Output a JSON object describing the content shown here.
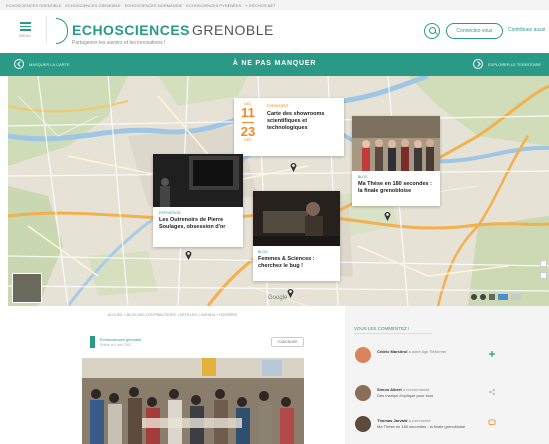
{
  "breadcrumb_top": [
    "ECHOSCIENCES GRENOBLE",
    "ECHOSCIENCES GRENOBLE",
    "ECHOSCIENCES NORMANDIE",
    "ECHOSCIENCES PYRÉNÉES",
    "+ D'ÉCHOS.NET"
  ],
  "header": {
    "menu_label": "MENU",
    "logo_main": "ECHOSCIENCES",
    "logo_city": "GRENOBLE",
    "tagline": "Partageons les savoirs et les innovations !",
    "connect_label": "Connectez-vous",
    "contribute_label": "Contribuez aussi"
  },
  "banner": {
    "left_label": "MASQUER LA CARTE",
    "title": "À NE PAS MANQUER",
    "right_label": "EXPLORER LE TERRITOIRE"
  },
  "map": {
    "cards": [
      {
        "kind": "event",
        "date_start": "11",
        "month_start": "DÉC",
        "date_end": "23",
        "month_end": "DÉC",
        "category": "ÉVÉNEMENT",
        "title": "Carte des showrooms scientifiques et technologiques"
      },
      {
        "kind": "article",
        "category": "EXPOSITION",
        "title": "Les Outrenoirs de Pierre Soulages, obsession d'or"
      },
      {
        "kind": "article",
        "category": "BLOG",
        "title": "Femmes & Sciences : cherchez le bug !"
      },
      {
        "kind": "article",
        "category": "BLOG",
        "title": "Ma Thèse en 180 secondes : la finale grenobloise"
      }
    ],
    "google_label": "Google"
  },
  "article": {
    "breadcrumb": "ACCUEIL > BLOG DES CONTRIBUTEURS > ARTICLES > AGENDA > DOSSIERS",
    "author_name": "Échosciences grenoble",
    "author_sub": "Publié le 6 déc 2017",
    "follow_label": "S'ABONNER"
  },
  "comments": {
    "title": "VOUS LES COMMENTEZ !",
    "items": [
      {
        "name": "Cédric Marsitrol",
        "action": "a aimé Agir Réformer",
        "text": "",
        "icon": "plus-icon",
        "avatar_color": "#d9845a"
      },
      {
        "name": "Simon Albert",
        "action": "a recommandé",
        "text": "Des manips d'optique pour tous",
        "icon": "share-icon",
        "avatar_color": "#8a6e55"
      },
      {
        "name": "Thomas Jarvaid",
        "action": "a commenté",
        "text": "Ma Thèse en 180 secondes : la finale grenobloise",
        "icon": "comment-icon",
        "avatar_color": "#5c4a3c"
      }
    ]
  },
  "colors": {
    "accent": "#2a9a86"
  }
}
